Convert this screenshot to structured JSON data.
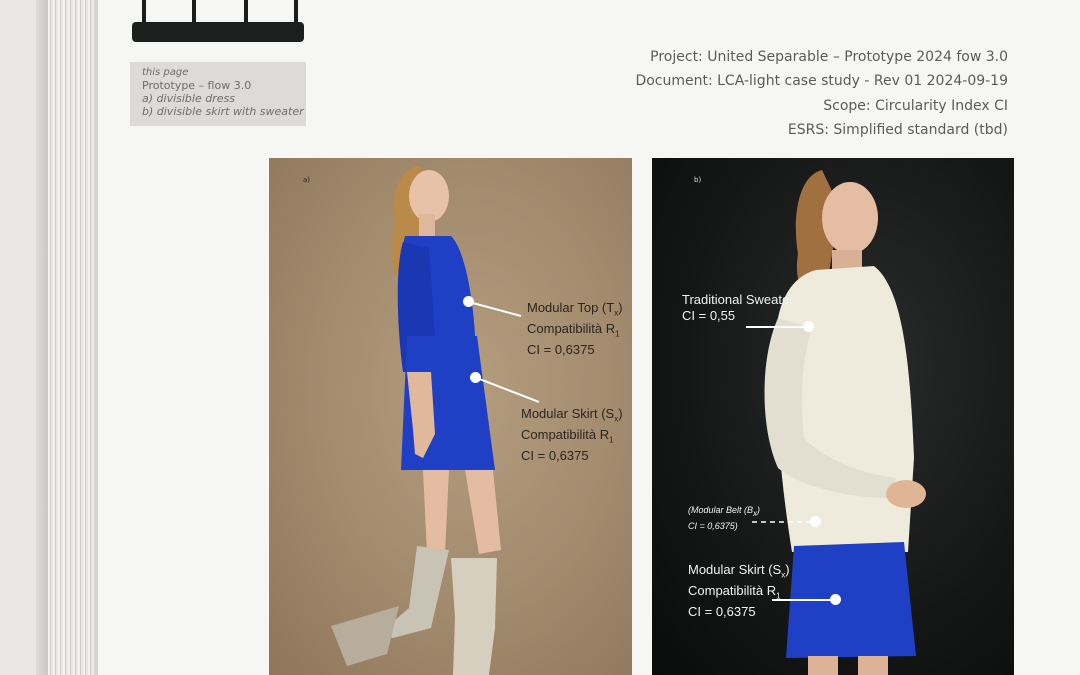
{
  "note": {
    "kicker": "this page",
    "line1": "Prototype – flow 3.0",
    "line2": "a) divisible dress",
    "line3": "b) divisible skirt with sweater"
  },
  "meta": {
    "project": "Project: United Separable – Prototype 2024 fow 3.0",
    "document": "Document: LCA-light case study - Rev 01 2024-09-19",
    "scope": "Scope: Circularity Index CI",
    "esrs": "ESRS: Simplified standard (tbd)"
  },
  "photo_a": {
    "tag": "a)",
    "top": {
      "name": "Modular Top (T",
      "sub": "x",
      "compat": "Compatibilità R",
      "compat_sub": "1",
      "ci": "CI = 0,6375"
    },
    "skirt": {
      "name": "Modular Skirt (S",
      "sub": "x",
      "compat": "Compatibilità R",
      "compat_sub": "1",
      "ci": "CI = 0,6375"
    }
  },
  "photo_b": {
    "tag": "b)",
    "sweater": {
      "name": "Traditional Sweater",
      "ci": "CI = 0,55"
    },
    "belt": {
      "name": "Modular Belt (B",
      "sub": "x",
      "ci": "CI = 0,6375)"
    },
    "skirt": {
      "name": "Modular Skirt (S",
      "sub": "x",
      "compat": "Compatibilità R",
      "compat_sub": "1",
      "ci": "CI = 0,6375"
    }
  },
  "colors": {
    "dress_blue": "#1f3fc4",
    "sweater_cream": "#eeebdd",
    "boot_silver": "#c9c3b6"
  }
}
